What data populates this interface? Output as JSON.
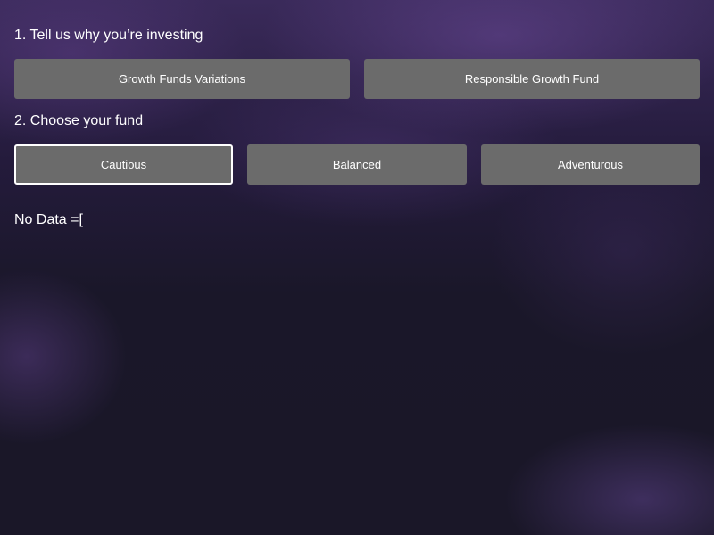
{
  "reason_section": {
    "title": "1. Tell us why you’re investing",
    "options": [
      {
        "label": "Growth Funds Variations"
      },
      {
        "label": "Responsible Growth Fund"
      }
    ]
  },
  "fund_section": {
    "title": "2. Choose your fund",
    "selected": "Cautious",
    "options": [
      {
        "label": "Cautious"
      },
      {
        "label": "Balanced"
      },
      {
        "label": "Adventurous"
      }
    ]
  },
  "result": {
    "message": "No Data =["
  },
  "colors": {
    "button_bg": "#6b6b6b",
    "selected_border": "#ffffff",
    "text": "#ffffff",
    "background_dark": "#1a1728",
    "background_purple": "#3a2a5a"
  }
}
